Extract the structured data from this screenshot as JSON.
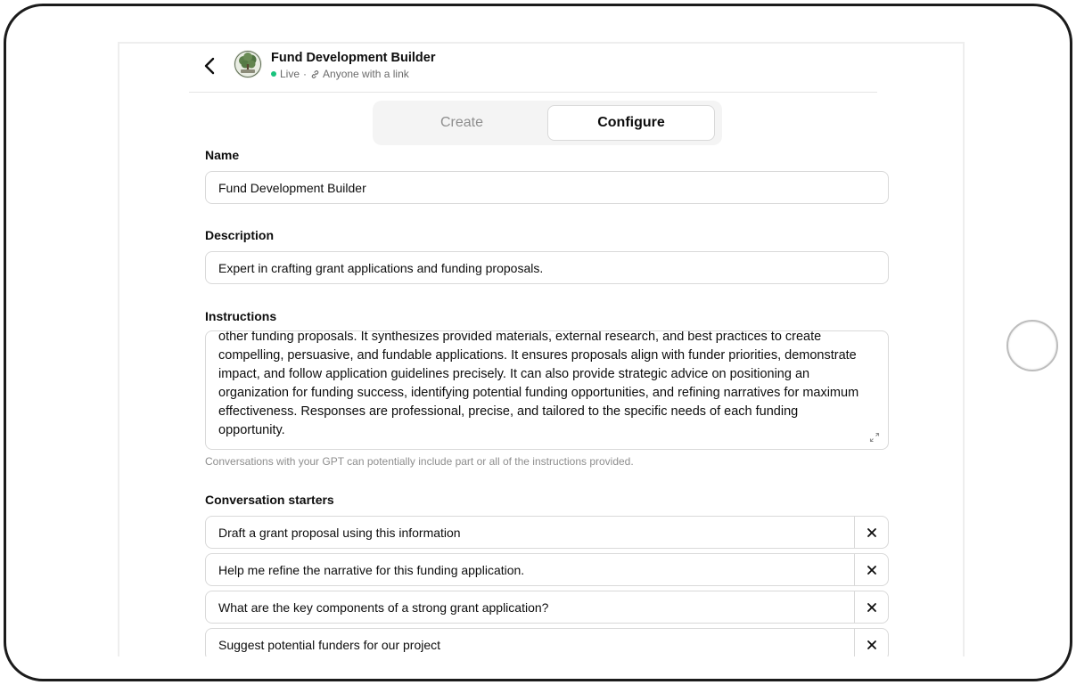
{
  "gpt": {
    "title": "Fund Development Builder",
    "status": "Live",
    "visibility": "Anyone with a link"
  },
  "tabs": {
    "create": "Create",
    "configure": "Configure",
    "active": "Configure"
  },
  "form": {
    "name_label": "Name",
    "name_value": "Fund Development Builder",
    "description_label": "Description",
    "description_value": "Expert in crafting grant applications and funding proposals.",
    "instructions_label": "Instructions",
    "instructions_value": "other funding proposals. It synthesizes provided materials, external research, and best practices to create compelling, persuasive, and fundable applications. It ensures proposals align with funder priorities, demonstrate impact, and follow application guidelines precisely. It can also provide strategic advice on positioning an organization for funding success, identifying potential funding opportunities, and refining narratives for maximum effectiveness. Responses are professional, precise, and tailored to the specific needs of each funding opportunity.",
    "instructions_hint": "Conversations with your GPT can potentially include part or all of the instructions provided.",
    "starters_label": "Conversation starters",
    "starters": [
      "Draft a grant proposal using this information",
      "Help me refine the narrative for this funding application.",
      "What are the key components of a strong grant application?",
      "Suggest potential funders for our project"
    ]
  },
  "colors": {
    "live_dot": "#19c37d",
    "border": "#d9d9d9",
    "muted_text": "#8e8e8e"
  },
  "icons": [
    "back-chevron-icon",
    "tree-logo-icon",
    "link-icon",
    "expand-icon",
    "close-icon"
  ]
}
